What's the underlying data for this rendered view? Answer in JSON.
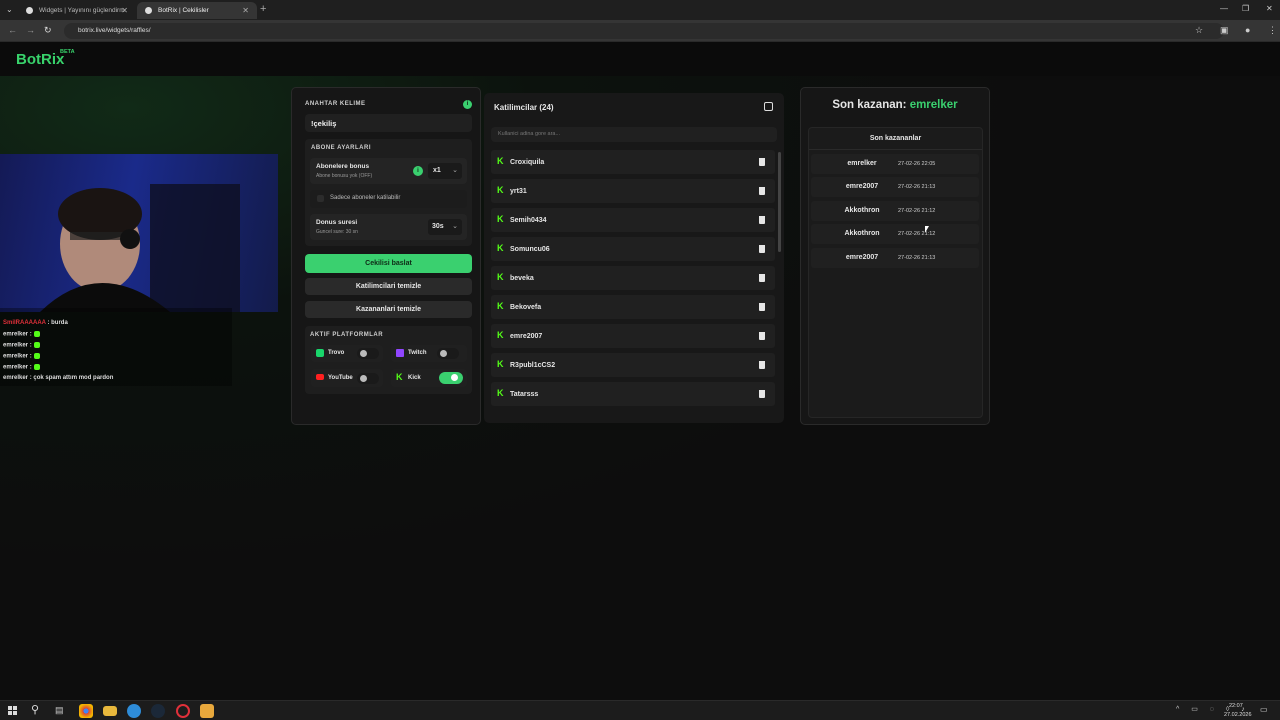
{
  "browser": {
    "tabs": [
      {
        "title": "Widgets | Yayınını güçlendirmek"
      },
      {
        "title": "BotRix | Cekilisler"
      }
    ],
    "url": "botrix.live/widgets/raffles/"
  },
  "site": {
    "logo": "BotRix",
    "beta": "BETA"
  },
  "keyword": {
    "label": "ANAHTAR KELIME",
    "value": "!çekiliş"
  },
  "subscriber": {
    "label": "ABONE AYARLARI",
    "bonus_title": "Abonelere bonus",
    "bonus_sub": "Abone bonusu yok (OFF)",
    "multiplier": "x1",
    "only_subs": "Sadece aboneler katilabilir",
    "duration_title": "Donus suresi",
    "duration_sub": "Guncel sure: 30 sn",
    "duration_value": "30s"
  },
  "buttons": {
    "start": "Cekilisi baslat",
    "clear_participants": "Katilimcilari temizle",
    "clear_winners": "Kazananlari temizle"
  },
  "platforms": {
    "label": "AKTIF PLATFORMLAR",
    "items": [
      {
        "name": "Trovo",
        "on": false
      },
      {
        "name": "Twitch",
        "on": false
      },
      {
        "name": "YouTube",
        "on": false
      },
      {
        "name": "Kick",
        "on": true
      }
    ]
  },
  "participants": {
    "title": "Katilimcilar (24)",
    "search_placeholder": "Kullanici adina gore ara...",
    "list": [
      "Croxiquila",
      "yrt31",
      "Semih0434",
      "Somuncu06",
      "beveka",
      "Bekovefa",
      "emre2007",
      "R3publ1cCS2",
      "Tatarsss"
    ]
  },
  "winners": {
    "last_label": "Son kazanan:",
    "last_name": "emrelker",
    "list_title": "Son kazananlar",
    "list": [
      {
        "name": "emrelker",
        "date": "27-02-26 22:05"
      },
      {
        "name": "emre2007",
        "date": "27-02-26 21:13"
      },
      {
        "name": "Akkothron",
        "date": "27-02-26 21:12"
      },
      {
        "name": "Akkothron",
        "date": "27-02-26 21:12"
      },
      {
        "name": "emre2007",
        "date": "27-02-26 21:13"
      }
    ]
  },
  "chat": [
    {
      "user": "SmilRAAAAAA",
      "msg": ": burda",
      "color": "#e0303a"
    },
    {
      "user": "emrelker",
      "msg": ":",
      "emote": true
    },
    {
      "user": "emrelker",
      "msg": ":",
      "emote": true
    },
    {
      "user": "emrelker",
      "msg": ":",
      "emote": true
    },
    {
      "user": "emrelker",
      "msg": ":",
      "emote": true
    },
    {
      "user": "emrelker",
      "msg": ": çok spam attım mod pardon"
    }
  ],
  "clock": {
    "time": "22:07",
    "date": "27.02.2026"
  },
  "colors": {
    "accent": "#3ad06f",
    "kick": "#53fc18"
  }
}
